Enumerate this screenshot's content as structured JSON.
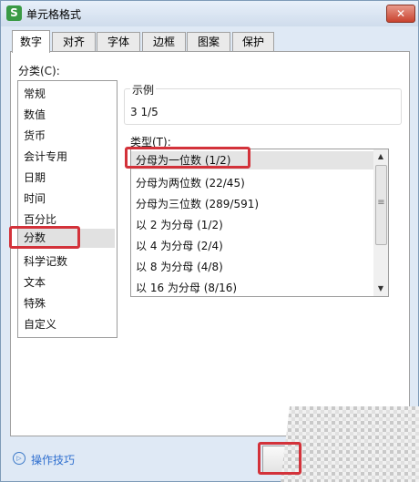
{
  "window": {
    "title": "单元格格式",
    "app_icon_glyph": "S",
    "close_glyph": "✕"
  },
  "tabs": [
    {
      "label": "数字",
      "active": true
    },
    {
      "label": "对齐",
      "active": false
    },
    {
      "label": "字体",
      "active": false
    },
    {
      "label": "边框",
      "active": false
    },
    {
      "label": "图案",
      "active": false
    },
    {
      "label": "保护",
      "active": false
    }
  ],
  "category": {
    "label": "分类(C):",
    "items": [
      "常规",
      "数值",
      "货币",
      "会计专用",
      "日期",
      "时间",
      "百分比",
      "分数",
      "科学记数",
      "文本",
      "特殊",
      "自定义"
    ],
    "selected": "分数"
  },
  "sample": {
    "legend": "示例",
    "value": "3 1/5"
  },
  "type": {
    "label": "类型(T):",
    "items": [
      "分母为一位数 (1/2)",
      "分母为两位数 (22/45)",
      "分母为三位数 (289/591)",
      "以 2 为分母 (1/2)",
      "以 4 为分母 (2/4)",
      "以 8 为分母 (4/8)",
      "以 16 为分母 (8/16)"
    ],
    "selected": "分母为一位数 (1/2)",
    "scroll_up_glyph": "▲",
    "scroll_down_glyph": "▼",
    "grip_glyph": "≡"
  },
  "footer": {
    "tips_label": "操作技巧",
    "tips_icon_glyph": "▷"
  },
  "colors": {
    "highlight": "#d3323a",
    "link": "#2f6fcf",
    "app_icon_bg": "#3a9a45",
    "close_bg": "#c9432f"
  }
}
